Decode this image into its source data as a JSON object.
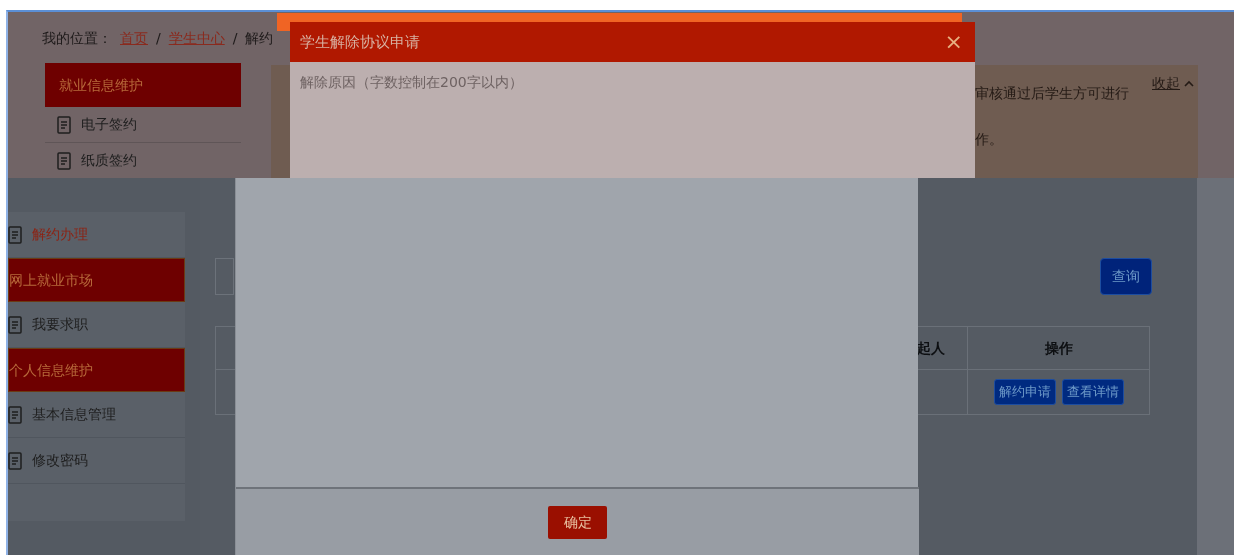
{
  "breadcrumb": {
    "label": "我的位置：",
    "items": [
      {
        "text": "首页"
      },
      {
        "separator": "/"
      },
      {
        "text": "学生中心"
      },
      {
        "separator": "/"
      },
      {
        "text": "解约"
      }
    ]
  },
  "sidebar_top": [
    {
      "kind": "header",
      "label": "就业信息维护"
    },
    {
      "kind": "item",
      "label": "电子签约",
      "selected": false
    },
    {
      "kind": "item",
      "label": "纸质签约",
      "selected": false
    }
  ],
  "notice": {
    "lines": [
      "审核通过后学生方可进行",
      "作。"
    ],
    "toggle": "收起"
  },
  "modal": {
    "title": "学生解除协议申请",
    "close": "×",
    "reason_placeholder": "解除原因（字数控制在200字以内）",
    "confirm": "确定"
  },
  "sidebar_bottom": [
    {
      "kind": "item",
      "label": "解约办理",
      "selected": true
    },
    {
      "kind": "header",
      "label": "网上就业市场"
    },
    {
      "kind": "item",
      "label": "我要求职",
      "selected": false
    },
    {
      "kind": "header",
      "label": "个人信息维护"
    },
    {
      "kind": "item",
      "label": "基本信息管理",
      "selected": false
    },
    {
      "kind": "item",
      "label": "修改密码",
      "selected": false
    }
  ],
  "search_button": "查询",
  "table": {
    "columns": [
      "起人",
      "操作"
    ],
    "rows": [
      {
        "actions": [
          "解约申请",
          "查看详情"
        ]
      }
    ]
  }
}
